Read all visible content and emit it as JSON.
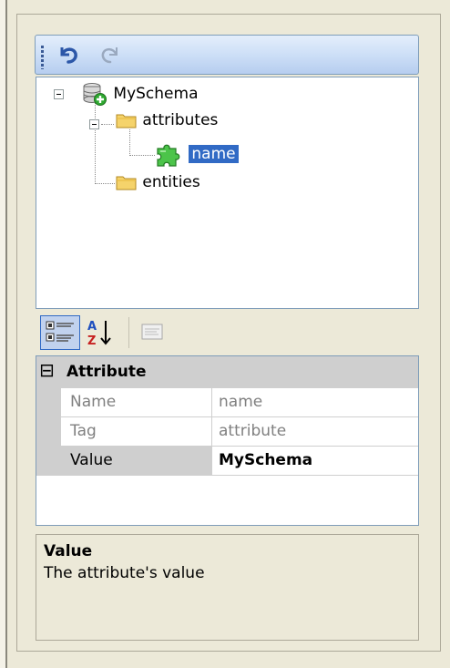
{
  "toolbar": {
    "undo_icon": "undo-icon",
    "redo_icon": "redo-icon"
  },
  "tree": {
    "root": {
      "label": "MySchema",
      "icon": "database-add-icon"
    },
    "attributes": {
      "label": "attributes",
      "icon": "folder-icon"
    },
    "name": {
      "label": "name",
      "icon": "puzzle-piece-icon",
      "selected": true
    },
    "entities": {
      "label": "entities",
      "icon": "folder-icon"
    }
  },
  "propertygrid": {
    "buttons": {
      "categorized": "categorized-icon",
      "alphabetical": "sort-az-icon",
      "property_pages": "property-pages-icon"
    },
    "category": {
      "toggle": "⊟",
      "label": "Attribute"
    },
    "rows": [
      {
        "name": "Name",
        "value": "name",
        "readonly": true
      },
      {
        "name": "Tag",
        "value": "attribute",
        "readonly": true
      },
      {
        "name": "Value",
        "value": "MySchema",
        "readonly": false
      }
    ]
  },
  "description": {
    "title": "Value",
    "text": "The attribute's value"
  },
  "colors": {
    "selection": "#316ac5",
    "gutter": "#cfcfcf",
    "toolbar_top": "#e4eefb",
    "toolbar_bottom": "#b6cdef",
    "background": "#ece9d8"
  }
}
